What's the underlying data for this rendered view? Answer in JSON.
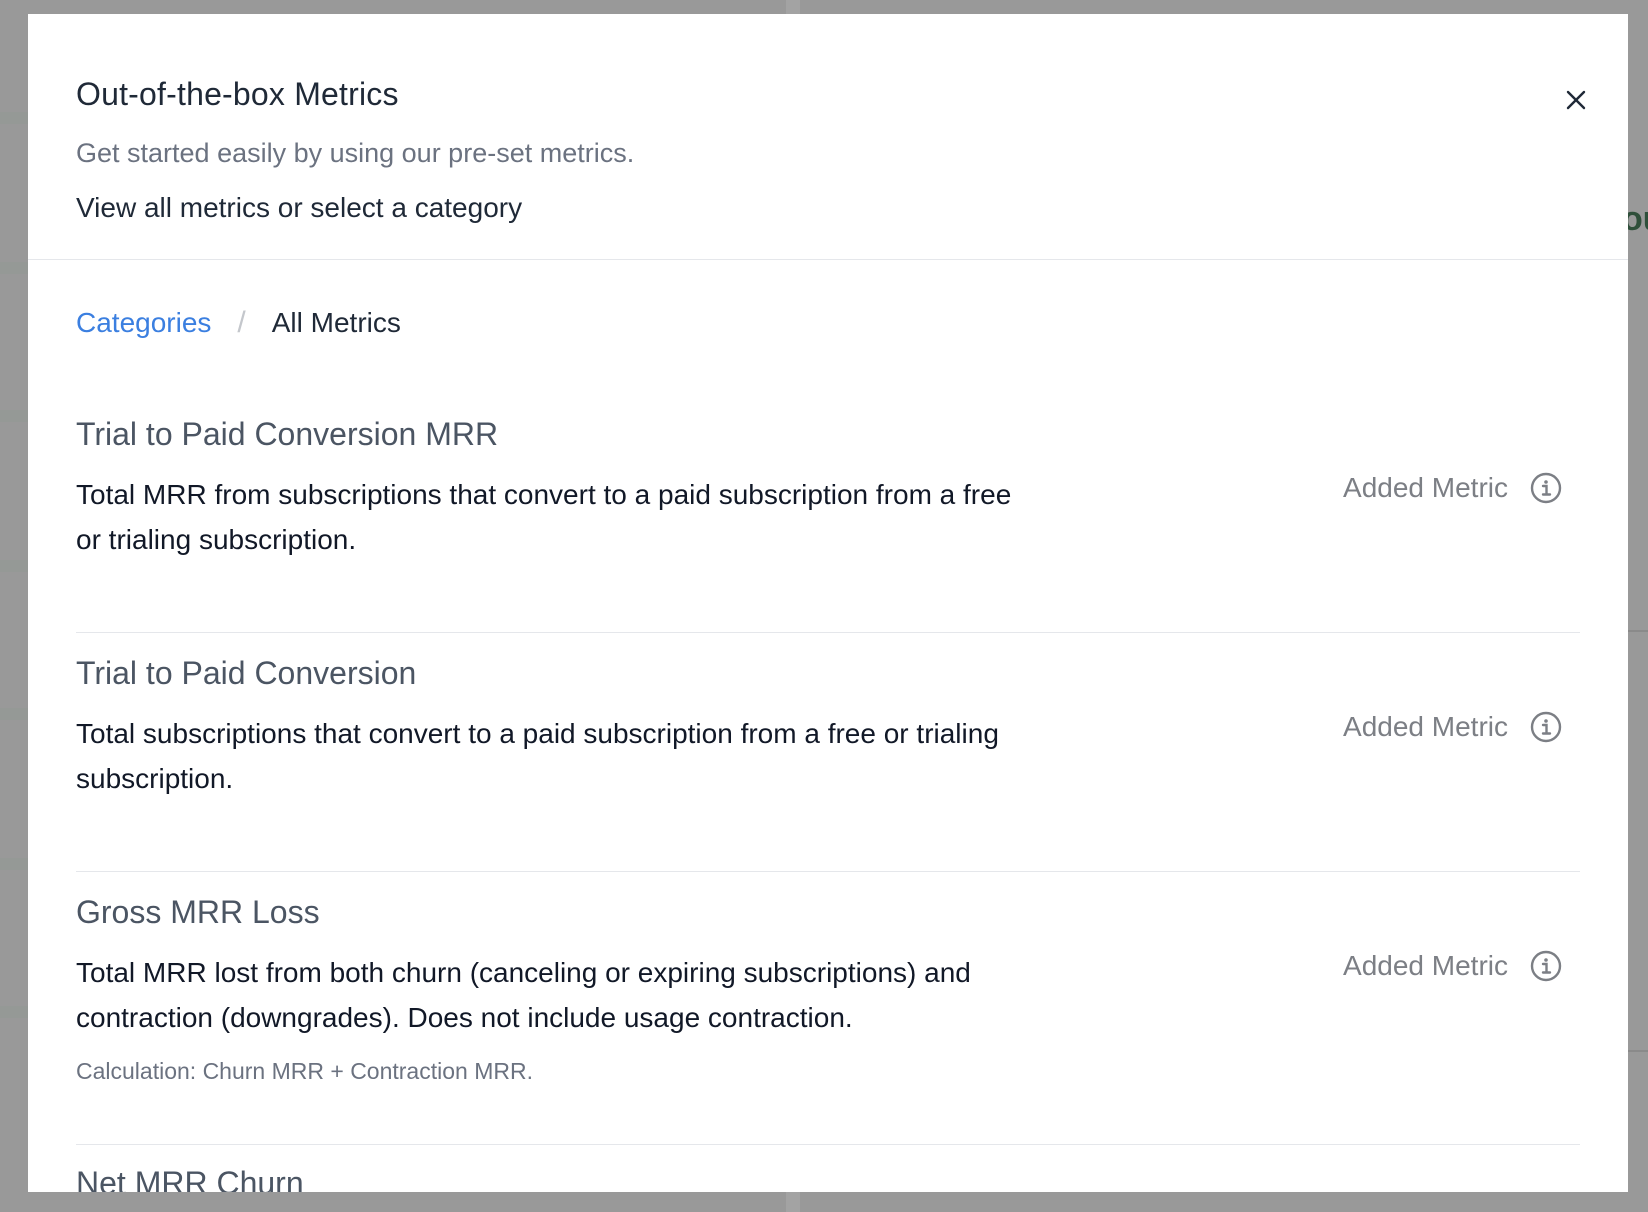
{
  "modal": {
    "title": "Out-of-the-box Metrics",
    "subtitle": "Get started easily by using our pre-set metrics.",
    "prompt": "View all metrics or select a category",
    "close_icon": "close-icon"
  },
  "breadcrumb": {
    "link": "Categories",
    "separator": "/",
    "current": "All Metrics"
  },
  "metrics": [
    {
      "name": "Trial to Paid Conversion MRR",
      "description": "Total MRR from subscriptions that convert to a paid subscription from a free or trialing subscription.",
      "status": "Added Metric",
      "status_icon": "info-icon"
    },
    {
      "name": "Trial to Paid Conversion",
      "description": "Total subscriptions that convert to a paid subscription from a free or trialing subscription.",
      "status": "Added Metric",
      "status_icon": "info-icon"
    },
    {
      "name": "Gross MRR Loss",
      "description": "Total MRR lost from both churn (canceling or expiring subscriptions) and contraction (downgrades). Does not include usage contraction.",
      "calculation": "Calculation: Churn MRR + Contraction MRR.",
      "status": "Added Metric",
      "status_icon": "info-icon"
    },
    {
      "name": "Net MRR Churn"
    }
  ],
  "background": {
    "peek_text": "ou"
  },
  "colors": {
    "overlay": "#999999",
    "link": "#3b7fe0",
    "title": "#1f2937",
    "muted": "#6b7280",
    "status": "#7c7f85"
  }
}
